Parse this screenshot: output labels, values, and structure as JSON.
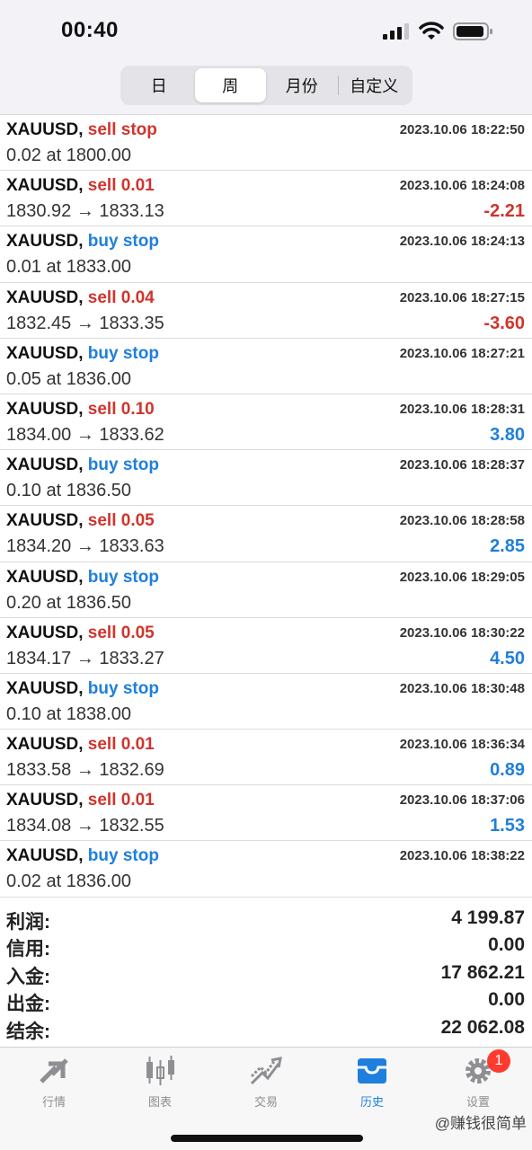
{
  "status_bar": {
    "time": "00:40"
  },
  "period_tabs": [
    {
      "label": "日",
      "active": false
    },
    {
      "label": "周",
      "active": true
    },
    {
      "label": "月份",
      "active": false
    },
    {
      "label": "自定义",
      "active": false
    }
  ],
  "orders": [
    {
      "symbol": "XAUUSD,",
      "type": "sell stop",
      "side": "sell",
      "time": "2023.10.06 18:22:50",
      "detail": "0.02 at 1800.00",
      "profit": ""
    },
    {
      "symbol": "XAUUSD,",
      "type": "sell 0.01",
      "side": "sell",
      "time": "2023.10.06 18:24:08",
      "detail": "1830.92 → 1833.13",
      "profit": "-2.21"
    },
    {
      "symbol": "XAUUSD,",
      "type": "buy stop",
      "side": "buy",
      "time": "2023.10.06 18:24:13",
      "detail": "0.01 at 1833.00",
      "profit": ""
    },
    {
      "symbol": "XAUUSD,",
      "type": "sell 0.04",
      "side": "sell",
      "time": "2023.10.06 18:27:15",
      "detail": "1832.45 → 1833.35",
      "profit": "-3.60"
    },
    {
      "symbol": "XAUUSD,",
      "type": "buy stop",
      "side": "buy",
      "time": "2023.10.06 18:27:21",
      "detail": "0.05 at 1836.00",
      "profit": ""
    },
    {
      "symbol": "XAUUSD,",
      "type": "sell 0.10",
      "side": "sell",
      "time": "2023.10.06 18:28:31",
      "detail": "1834.00 → 1833.62",
      "profit": "3.80"
    },
    {
      "symbol": "XAUUSD,",
      "type": "buy stop",
      "side": "buy",
      "time": "2023.10.06 18:28:37",
      "detail": "0.10 at 1836.50",
      "profit": ""
    },
    {
      "symbol": "XAUUSD,",
      "type": "sell 0.05",
      "side": "sell",
      "time": "2023.10.06 18:28:58",
      "detail": "1834.20 → 1833.63",
      "profit": "2.85"
    },
    {
      "symbol": "XAUUSD,",
      "type": "buy stop",
      "side": "buy",
      "time": "2023.10.06 18:29:05",
      "detail": "0.20 at 1836.50",
      "profit": ""
    },
    {
      "symbol": "XAUUSD,",
      "type": "sell 0.05",
      "side": "sell",
      "time": "2023.10.06 18:30:22",
      "detail": "1834.17 → 1833.27",
      "profit": "4.50"
    },
    {
      "symbol": "XAUUSD,",
      "type": "buy stop",
      "side": "buy",
      "time": "2023.10.06 18:30:48",
      "detail": "0.10 at 1838.00",
      "profit": ""
    },
    {
      "symbol": "XAUUSD,",
      "type": "sell 0.01",
      "side": "sell",
      "time": "2023.10.06 18:36:34",
      "detail": "1833.58 → 1832.69",
      "profit": "0.89"
    },
    {
      "symbol": "XAUUSD,",
      "type": "sell 0.01",
      "side": "sell",
      "time": "2023.10.06 18:37:06",
      "detail": "1834.08 → 1832.55",
      "profit": "1.53"
    },
    {
      "symbol": "XAUUSD,",
      "type": "buy stop",
      "side": "buy",
      "time": "2023.10.06 18:38:22",
      "detail": "0.02 at 1836.00",
      "profit": ""
    }
  ],
  "summary": [
    {
      "label": "利润:",
      "value": "4 199.87"
    },
    {
      "label": "信用:",
      "value": "0.00"
    },
    {
      "label": "入金:",
      "value": "17 862.21"
    },
    {
      "label": "出金:",
      "value": "0.00"
    },
    {
      "label": "结余:",
      "value": "22 062.08"
    }
  ],
  "tabbar": [
    {
      "label": "行情",
      "icon": "quotes-icon",
      "active": false
    },
    {
      "label": "图表",
      "icon": "chart-icon",
      "active": false
    },
    {
      "label": "交易",
      "icon": "trade-icon",
      "active": false
    },
    {
      "label": "历史",
      "icon": "history-icon",
      "active": true
    },
    {
      "label": "设置",
      "icon": "settings-icon",
      "active": false,
      "badge": "1"
    }
  ],
  "watermark": "@赚钱很简单",
  "colors": {
    "sell": "#d0342c",
    "buy": "#1f7fdc",
    "active_tab": "#1f7fdc",
    "badge": "#ff3b30"
  }
}
